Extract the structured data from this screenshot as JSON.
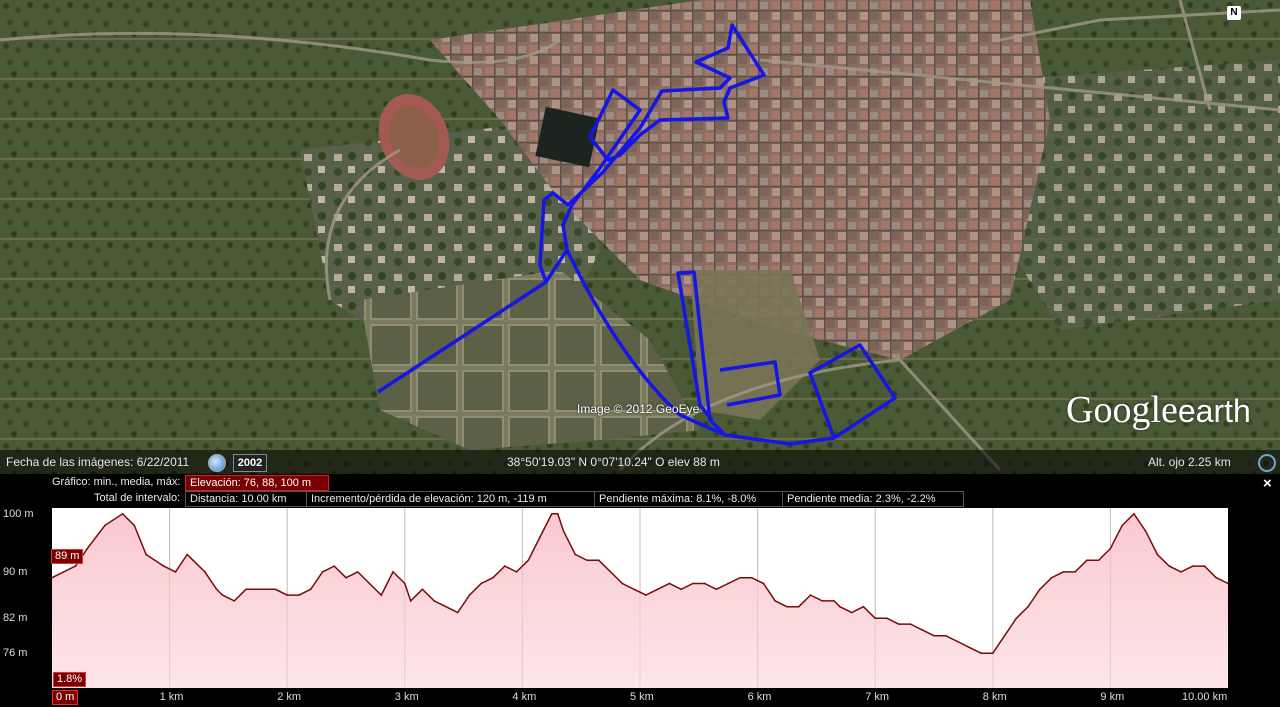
{
  "map": {
    "north_label": "N",
    "copyright": "Image © 2012 GeoEye",
    "logo_google": "Google",
    "logo_earth": "earth",
    "route_color": "#1515e6"
  },
  "status": {
    "imagery_date": "Fecha de las imágenes: 6/22/2011",
    "history_year": "2002",
    "coordinates": "38°50'19.03\" N    0°07'10.24\" O  elev    88 m",
    "eye_alt": "Alt. ojo    2.25 km"
  },
  "profile": {
    "graph_label": "Gráfico: min., media, máx:",
    "elevation": "Elevación: 76, 88, 100 m",
    "range_total_label": "Total de intervalo:",
    "distance": "Distancia: 10.00 km",
    "gain_loss": "Incremento/pérdida de elevación: 120 m, -119 m",
    "max_slope": "Pendiente máxima: 8.1%, -8.0%",
    "avg_slope": "Pendiente media: 2.3%, -2.2%",
    "cursor_elev": "89 m",
    "cursor_slope": "1.8%",
    "close": "×"
  },
  "chart_data": {
    "type": "area",
    "xlabel": "",
    "ylabel": "",
    "xlim": [
      0,
      10
    ],
    "ylim": [
      70,
      101
    ],
    "y_ticks": [
      {
        "value": 100,
        "label": "100 m"
      },
      {
        "value": 90,
        "label": "90 m"
      },
      {
        "value": 82,
        "label": "82 m"
      },
      {
        "value": 76,
        "label": "76 m"
      }
    ],
    "x_ticks": [
      {
        "value": 0,
        "label": "0 m"
      },
      {
        "value": 1,
        "label": "1 km"
      },
      {
        "value": 2,
        "label": "2 km"
      },
      {
        "value": 3,
        "label": "3 km"
      },
      {
        "value": 4,
        "label": "4 km"
      },
      {
        "value": 5,
        "label": "5 km"
      },
      {
        "value": 6,
        "label": "6 km"
      },
      {
        "value": 7,
        "label": "7 km"
      },
      {
        "value": 8,
        "label": "8 km"
      },
      {
        "value": 9,
        "label": "9 km"
      },
      {
        "value": 10,
        "label": "10.00 km"
      }
    ],
    "series": [
      {
        "x": [
          0,
          0.2,
          0.3,
          0.45,
          0.6,
          0.7,
          0.8,
          0.95,
          1.05,
          1.15,
          1.2,
          1.3,
          1.4,
          1.45,
          1.55,
          1.65,
          1.7,
          1.8,
          1.9,
          2.0,
          2.1,
          2.2,
          2.3,
          2.4,
          2.5,
          2.6,
          2.7,
          2.8,
          2.9,
          3.0,
          3.05,
          3.15,
          3.25,
          3.35,
          3.45,
          3.55,
          3.65,
          3.75,
          3.85,
          3.95,
          4.05,
          4.15,
          4.25,
          4.3,
          4.35,
          4.45,
          4.55,
          4.65,
          4.75,
          4.85,
          4.95,
          5.05,
          5.15,
          5.25,
          5.35,
          5.45,
          5.55,
          5.65,
          5.75,
          5.85,
          5.95,
          6.05,
          6.15,
          6.25,
          6.35,
          6.45,
          6.55,
          6.65,
          6.7,
          6.8,
          6.9,
          7.0,
          7.1,
          7.2,
          7.3,
          7.4,
          7.5,
          7.6,
          7.7,
          7.8,
          7.9,
          8.0,
          8.1,
          8.2,
          8.3,
          8.4,
          8.5,
          8.6,
          8.7,
          8.8,
          8.9,
          9.0,
          9.1,
          9.2,
          9.3,
          9.4,
          9.5,
          9.6,
          9.7,
          9.8,
          9.9,
          10.0
        ],
        "y": [
          89,
          91,
          94,
          98,
          100,
          98,
          93,
          91,
          90,
          93,
          92,
          90,
          87,
          86,
          85,
          87,
          87,
          87,
          87,
          86,
          86,
          87,
          90,
          91,
          89,
          90,
          88,
          86,
          90,
          88,
          85,
          87,
          85,
          84,
          83,
          86,
          88,
          89,
          91,
          90,
          92,
          96,
          100,
          100,
          97,
          93,
          92,
          92,
          90,
          88,
          87,
          86,
          87,
          88,
          87,
          88,
          88,
          87,
          88,
          89,
          89,
          88,
          85,
          84,
          84,
          86,
          85,
          85,
          84,
          83,
          84,
          82,
          82,
          81,
          81,
          80,
          79,
          79,
          78,
          77,
          76,
          76,
          79,
          82,
          84,
          87,
          89,
          90,
          90,
          92,
          92,
          94,
          98,
          100,
          97,
          93,
          91,
          90,
          91,
          91,
          89,
          88
        ]
      }
    ]
  }
}
